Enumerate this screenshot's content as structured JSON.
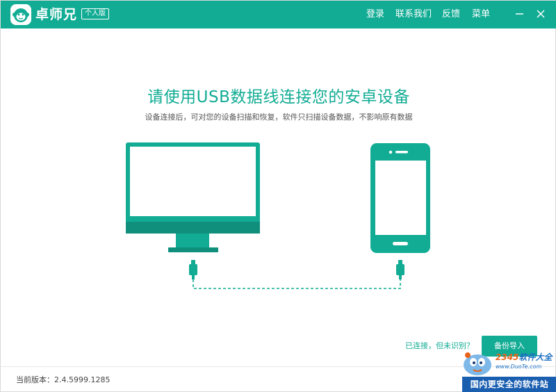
{
  "app": {
    "name": "卓师兄",
    "edition": "个人版"
  },
  "nav": {
    "login": "登录",
    "contact": "联系我们",
    "feedback": "反馈",
    "menu": "菜单"
  },
  "main": {
    "headline": "请使用USB数据线连接您的安卓设备",
    "subline": "设备连接后，可对您的设备扫描和恢复，软件只扫描设备数据，不影响原有数据"
  },
  "connection": {
    "status": "已连接，但未识别？",
    "backup_import_label": "备份导入"
  },
  "footer": {
    "version": "当前版本：2.4.5999.1285"
  },
  "watermark": {
    "brand_digits": "2345",
    "brand_text": "软件大全",
    "url": "www.DuoTe.com",
    "slogan": "国内更安全的软件站"
  },
  "colors": {
    "accent": "#12ac94",
    "device_dark": "#0f8f7c",
    "watermark_blue": "#1a5eb0"
  },
  "icons": {
    "logo": "monkey-face-icon",
    "minimize": "minimize-icon",
    "close": "close-icon",
    "monitor": "monitor-icon",
    "phone": "phone-icon",
    "usb_plug": "usb-plug-icon"
  }
}
